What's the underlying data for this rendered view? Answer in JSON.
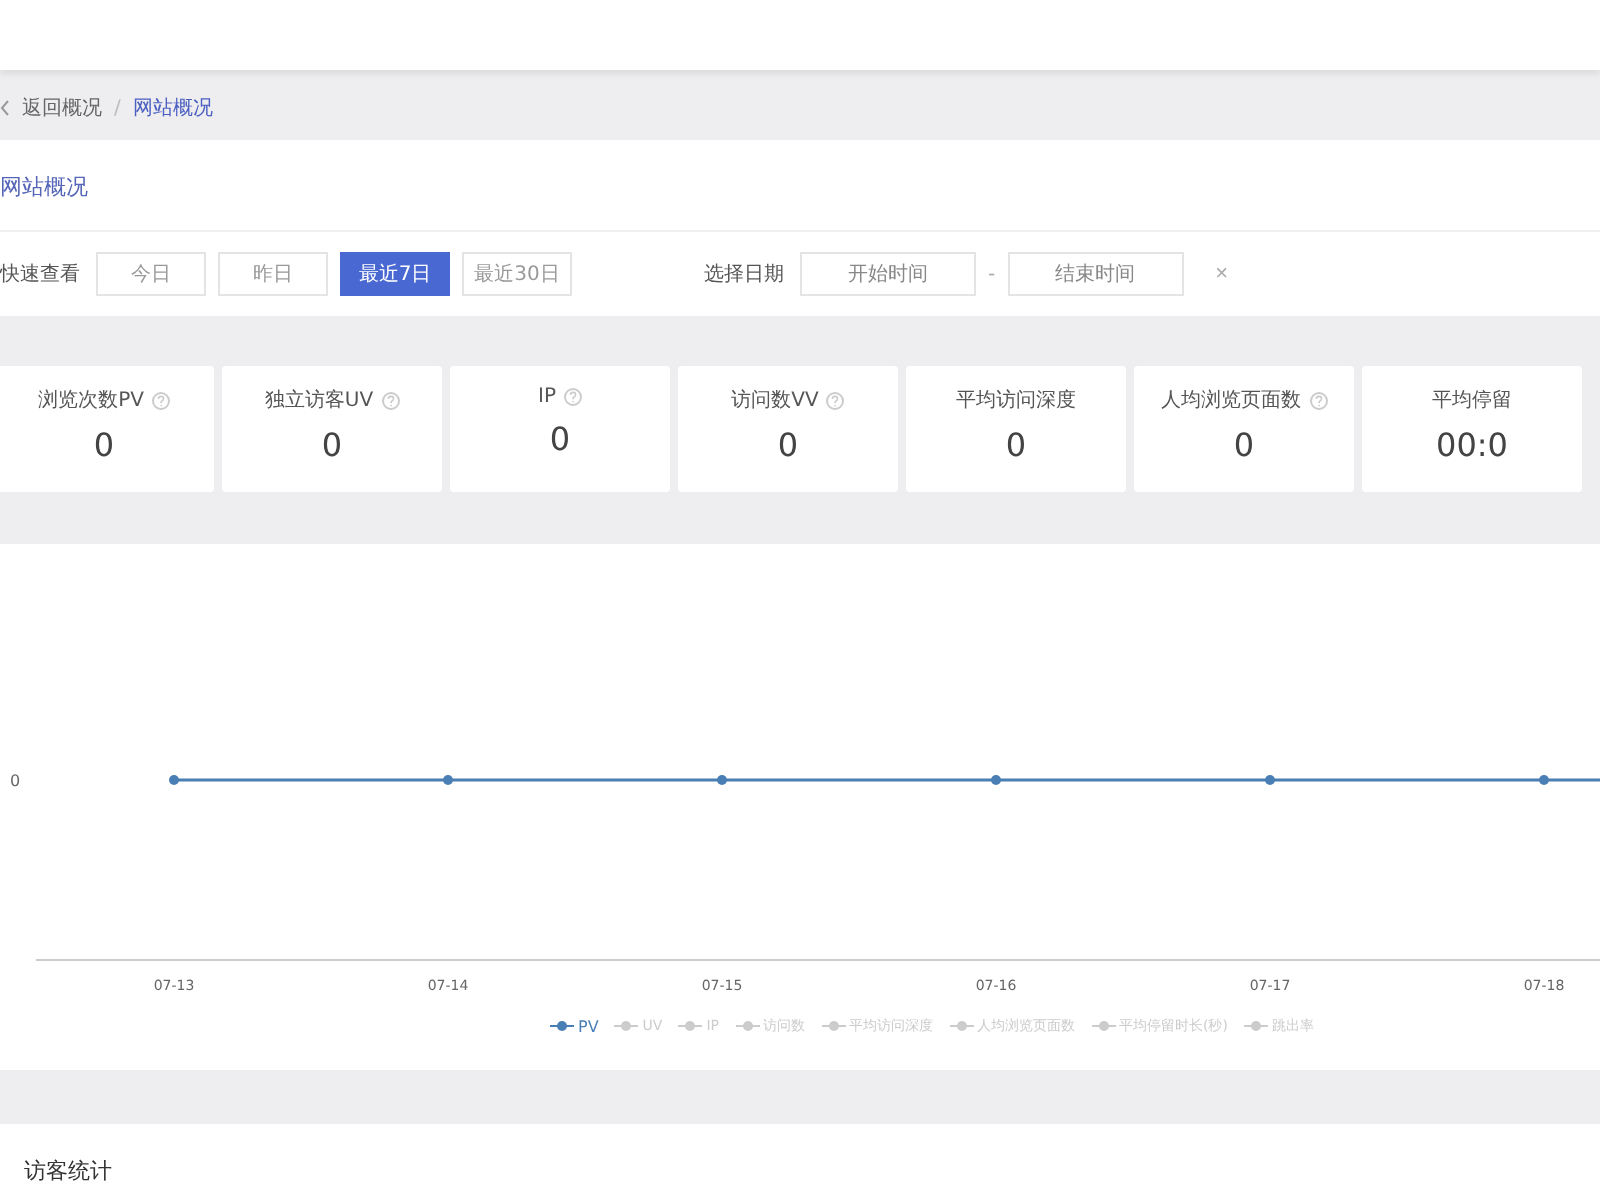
{
  "breadcrumb": {
    "items": [
      {
        "label": "返回概况",
        "selected": false
      },
      {
        "label": "网站概况",
        "selected": true
      }
    ],
    "separator": "/"
  },
  "page_title": "网站概况",
  "filter": {
    "quick_label": "快速查看",
    "ranges": [
      {
        "label": "今日",
        "selected": false
      },
      {
        "label": "昨日",
        "selected": false
      },
      {
        "label": "最近7日",
        "selected": true
      },
      {
        "label": "最近30日",
        "selected": false
      }
    ],
    "date_label": "选择日期",
    "start": {
      "placeholder": "开始时间"
    },
    "dash": "-",
    "end": {
      "placeholder": "结束时间"
    },
    "clear": "×"
  },
  "stats": [
    {
      "label": "浏览次数PV",
      "value": "0",
      "help_icon": true
    },
    {
      "label": "独立访客UV",
      "value": "0",
      "help_icon": true
    },
    {
      "label": "IP",
      "value": "0",
      "help_icon": true
    },
    {
      "label": "访问数VV",
      "value": "0",
      "help_icon": true
    },
    {
      "label": "平均访问深度",
      "value": "0",
      "help_icon": false
    },
    {
      "label": "人均浏览页面数",
      "value": "0",
      "help_icon": true
    },
    {
      "label": "平均停留",
      "value": "00:0",
      "help_icon": false
    }
  ],
  "chart": {
    "y_axis_label": "0",
    "x_labels": [
      "07-13",
      "07-14",
      "07-15",
      "07-16",
      "07-17",
      "07-18"
    ],
    "legend": [
      {
        "label": "PV",
        "selected": true
      },
      {
        "label": "UV",
        "selected": false
      },
      {
        "label": "IP",
        "selected": false
      },
      {
        "label": "访问数",
        "selected": false
      },
      {
        "label": "平均访问深度",
        "selected": false
      },
      {
        "label": "人均浏览页面数",
        "selected": false
      },
      {
        "label": "平均停留时长(秒)",
        "selected": false
      },
      {
        "label": "跳出率",
        "selected": false
      }
    ]
  },
  "section_title": "访客统计"
}
